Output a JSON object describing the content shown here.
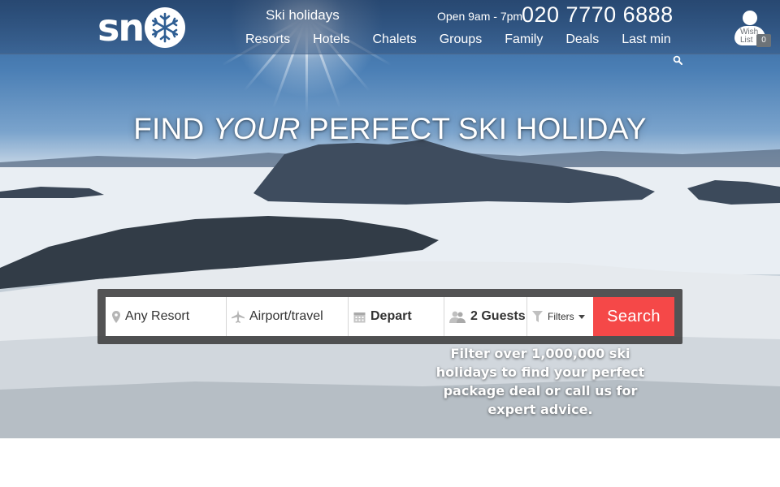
{
  "nav": {
    "logo_text": "sn",
    "subtitle": "Ski holidays",
    "hours": "Open 9am - 7pm",
    "phone": "020 7770 6888",
    "links": [
      "Resorts",
      "Hotels",
      "Chalets",
      "Groups",
      "Family",
      "Deals",
      "Last min"
    ],
    "wish_label": "Wish List",
    "wish_count": "0",
    "icons": {
      "logo": "snowflake-icon",
      "search": "search-icon",
      "account": "user-icon"
    }
  },
  "hero": {
    "headline_pre": "FIND ",
    "headline_em": "YOUR",
    "headline_post": " PERFECT SKI HOLIDAY"
  },
  "search": {
    "resort": "Any Resort",
    "airport": "Airport/travel",
    "depart": "Depart",
    "guests": "2 Guests",
    "filters": "Filters",
    "button": "Search",
    "tagline": "Filter over 1,000,000 ski holidays to find your perfect package deal or call us for expert advice.",
    "icons": {
      "resort": "map-marker-icon",
      "airport": "plane-icon",
      "depart": "calendar-icon",
      "guests": "users-icon",
      "filters": "funnel-icon",
      "dropdown": "caret-down-icon"
    }
  },
  "colors": {
    "search_button": "#f54848",
    "nav_overlay": "#2c4f7e",
    "search_panel": "#323232"
  }
}
